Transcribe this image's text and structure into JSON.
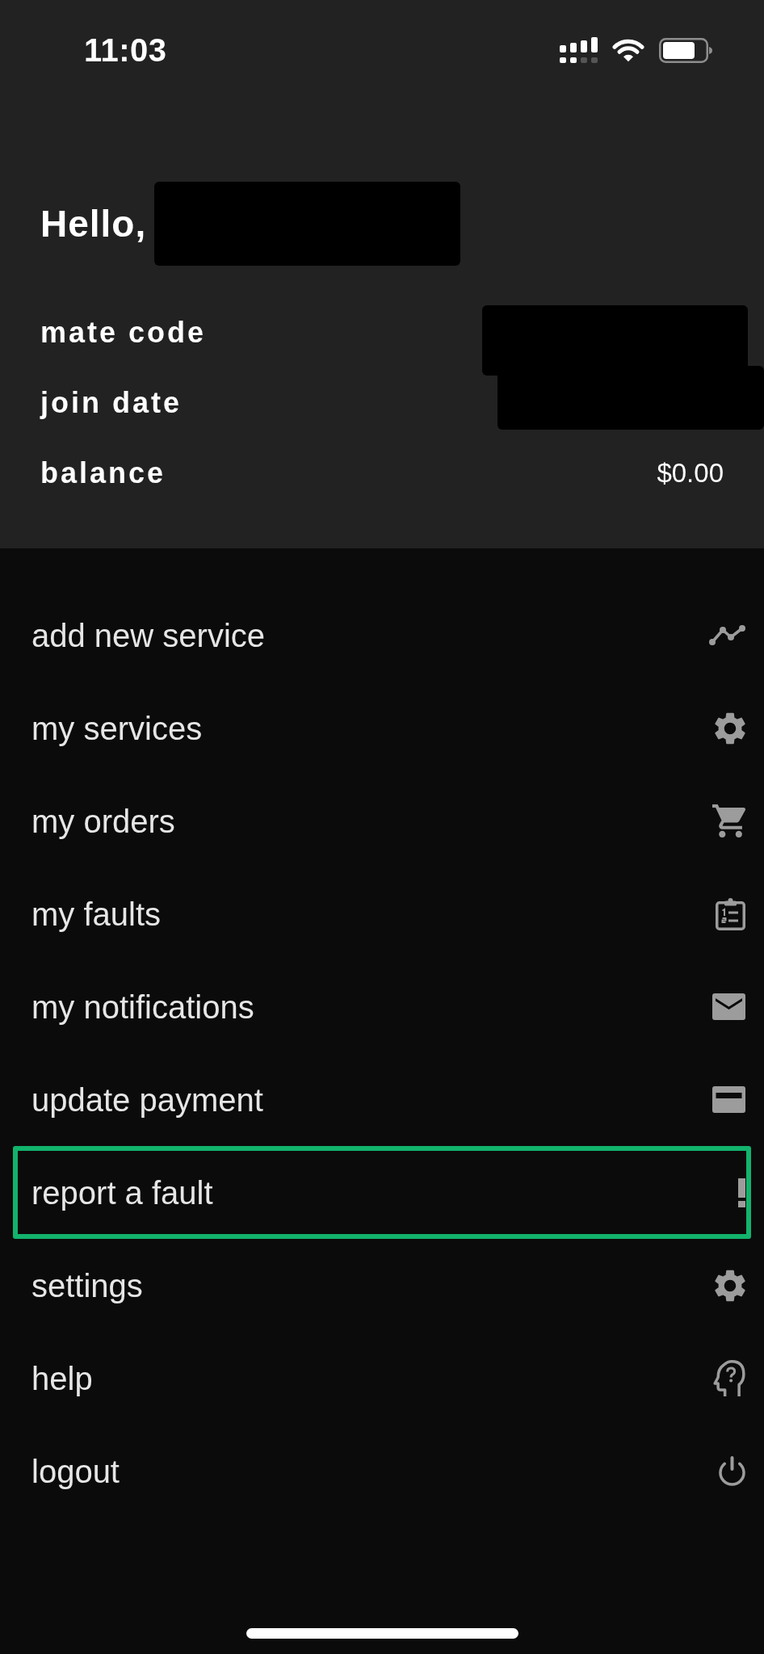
{
  "status_bar": {
    "time": "11:03"
  },
  "profile": {
    "greeting": "Hello,",
    "name_redacted": true,
    "fields": [
      {
        "label": "mate code",
        "redacted": true
      },
      {
        "label": "join date",
        "redacted": true
      },
      {
        "label": "balance",
        "value": "$0.00",
        "redacted": false
      }
    ]
  },
  "menu": {
    "items": [
      {
        "label": "add new service",
        "selected": false
      },
      {
        "label": "my services",
        "selected": false
      },
      {
        "label": "my orders",
        "selected": false
      },
      {
        "label": "my faults",
        "selected": false
      },
      {
        "label": "my notifications",
        "selected": false
      },
      {
        "label": "update payment",
        "selected": false
      },
      {
        "label": "report a fault",
        "selected": true
      },
      {
        "label": "settings",
        "selected": false
      },
      {
        "label": "help",
        "selected": false
      },
      {
        "label": "logout",
        "selected": false
      }
    ]
  }
}
